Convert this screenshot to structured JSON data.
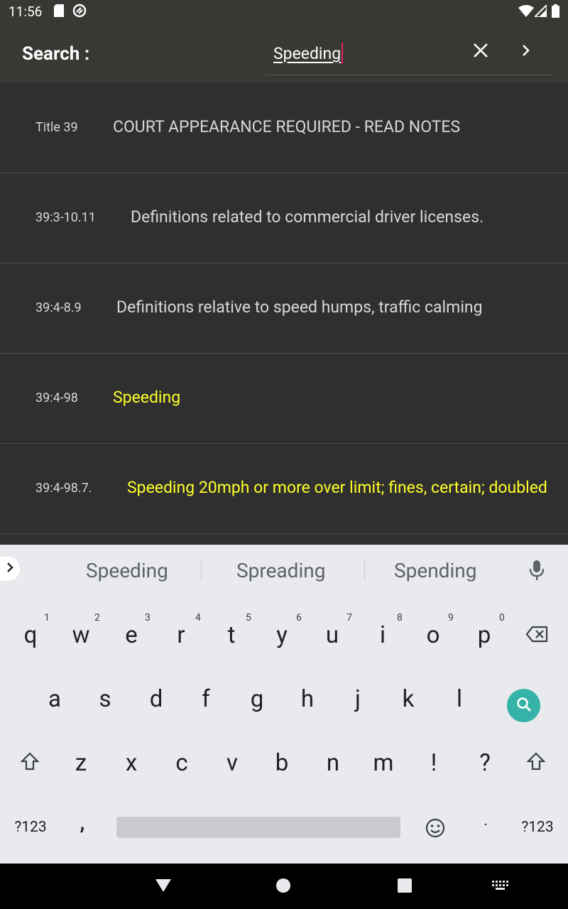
{
  "status_bar": {
    "time": "11:56"
  },
  "search": {
    "label": "Search :",
    "value": "Speeding"
  },
  "results": [
    {
      "code": "Title 39",
      "title": "COURT APPEARANCE REQUIRED - READ NOTES",
      "highlight": false
    },
    {
      "code": "39:3-10.11",
      "title": "Definitions related to commercial driver licenses.",
      "highlight": false
    },
    {
      "code": "39:4-8.9",
      "title": "Definitions relative to speed humps, traffic calming",
      "highlight": false
    },
    {
      "code": "39:4-98",
      "title": "Speeding",
      "highlight": true
    },
    {
      "code": "39:4-98.7.",
      "title": "Speeding 20mph or more over limit; fines, certain; doubled",
      "highlight": true
    }
  ],
  "colors": {
    "highlight": "#ffff2a",
    "normal_text": "#d8d8d8",
    "search_button": "#36b3a8"
  },
  "keyboard": {
    "suggestions": [
      "Speeding",
      "Spreading",
      "Spending"
    ],
    "row1": [
      "q",
      "w",
      "e",
      "r",
      "t",
      "y",
      "u",
      "i",
      "o",
      "p"
    ],
    "row1_hints": [
      "1",
      "2",
      "3",
      "4",
      "5",
      "6",
      "7",
      "8",
      "9",
      "0"
    ],
    "row2": [
      "a",
      "s",
      "d",
      "f",
      "g",
      "h",
      "j",
      "k",
      "l"
    ],
    "row3": [
      "z",
      "x",
      "c",
      "v",
      "b",
      "n",
      "m",
      "!",
      "?"
    ],
    "symbols_label": "?123",
    "comma": ",",
    "period": "·"
  }
}
